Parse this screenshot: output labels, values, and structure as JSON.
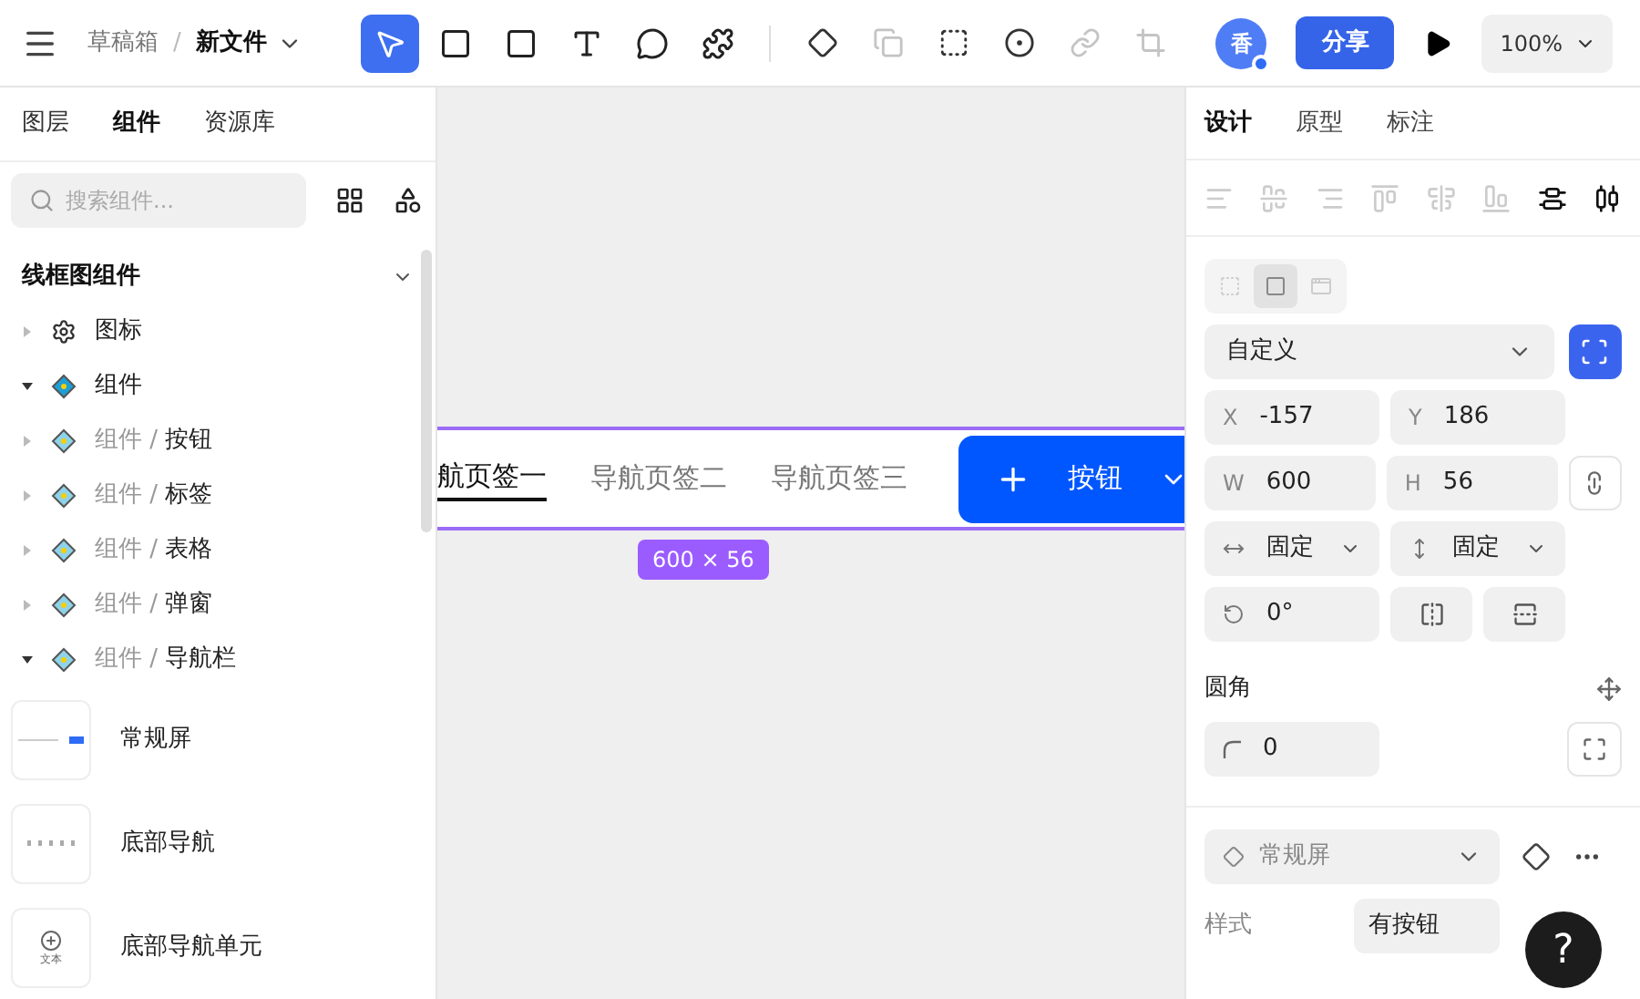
{
  "toolbar": {
    "breadcrumb": [
      "草稿箱",
      "新文件"
    ],
    "separator": "/",
    "tools": [
      {
        "kind": "pointer",
        "selected": true
      },
      {
        "kind": "frame",
        "selected": false
      },
      {
        "kind": "rect",
        "selected": false
      },
      {
        "kind": "text",
        "selected": false
      },
      {
        "kind": "comment",
        "selected": false
      },
      {
        "kind": "plugin",
        "selected": false
      }
    ],
    "actions": [
      {
        "kind": "component",
        "disabled": false
      },
      {
        "kind": "boolean",
        "disabled": true
      },
      {
        "kind": "selection",
        "disabled": false
      },
      {
        "kind": "mask",
        "disabled": false
      },
      {
        "kind": "link",
        "disabled": true
      },
      {
        "kind": "crop",
        "disabled": true
      }
    ],
    "avatar": "香",
    "share": "分享",
    "zoom": "100%"
  },
  "left_panel": {
    "tabs": [
      {
        "label": "图层",
        "selected": false
      },
      {
        "label": "组件",
        "selected": true
      },
      {
        "label": "资源库",
        "selected": false
      }
    ],
    "search": {
      "placeholder": "搜索组件..."
    },
    "section": "线框图组件",
    "tree": [
      {
        "kind": "icon-set",
        "label": "图标",
        "expanded": false
      },
      {
        "kind": "component",
        "label": "组件",
        "expanded": true,
        "children": [
          {
            "kind": "sub",
            "prefix": "组件 / ",
            "label": "按钮",
            "expanded": false
          },
          {
            "kind": "sub",
            "prefix": "组件 / ",
            "label": "标签",
            "expanded": false
          },
          {
            "kind": "sub",
            "prefix": "组件 / ",
            "label": "表格",
            "expanded": false
          },
          {
            "kind": "sub",
            "prefix": "组件 / ",
            "label": "弹窗",
            "expanded": false
          },
          {
            "kind": "sub",
            "prefix": "组件 / ",
            "label": "导航栏",
            "expanded": true,
            "children": [
              {
                "kind": "navbar",
                "label": "常规屏"
              },
              {
                "kind": "bottom-nav",
                "label": "底部导航"
              },
              {
                "kind": "nav-cell",
                "label": "底部导航单元",
                "thumb_text": "文本"
              }
            ]
          }
        ]
      }
    ]
  },
  "canvas": {
    "tabs": [
      {
        "label": "航页签一",
        "selected": true
      },
      {
        "label": "导航页签二",
        "selected": false
      },
      {
        "label": "导航页签三",
        "selected": false
      }
    ],
    "button": "按钮",
    "size": "600 × 56"
  },
  "right_panel": {
    "tabs": [
      {
        "label": "设计",
        "selected": true
      },
      {
        "label": "原型",
        "selected": false
      },
      {
        "label": "标注",
        "selected": false
      }
    ],
    "align": [
      {
        "kind": "left",
        "disabled": true
      },
      {
        "kind": "hcenter",
        "disabled": true
      },
      {
        "kind": "right",
        "disabled": true
      },
      {
        "kind": "top",
        "disabled": true
      },
      {
        "kind": "vcenter",
        "disabled": true
      },
      {
        "kind": "bottom",
        "disabled": true
      },
      {
        "kind": "vdistribute",
        "disabled": false
      },
      {
        "kind": "hdistribute",
        "disabled": false
      }
    ],
    "frame_modes": [
      {
        "kind": "none",
        "selected": false
      },
      {
        "kind": "fill",
        "selected": true
      },
      {
        "kind": "window",
        "selected": false
      }
    ],
    "preset": "自定义",
    "fields": [
      {
        "label": "X",
        "value": "-157"
      },
      {
        "label": "Y",
        "value": "186"
      },
      {
        "label": "W",
        "value": "600"
      },
      {
        "label": "H",
        "value": "56"
      }
    ],
    "resizing": [
      "固定",
      "固定"
    ],
    "rotation": "0°",
    "radius_label": "圆角",
    "radius": "0",
    "component_select": "常规屏",
    "style_label": "样式",
    "style_value": "有按钮"
  },
  "help": "?"
}
